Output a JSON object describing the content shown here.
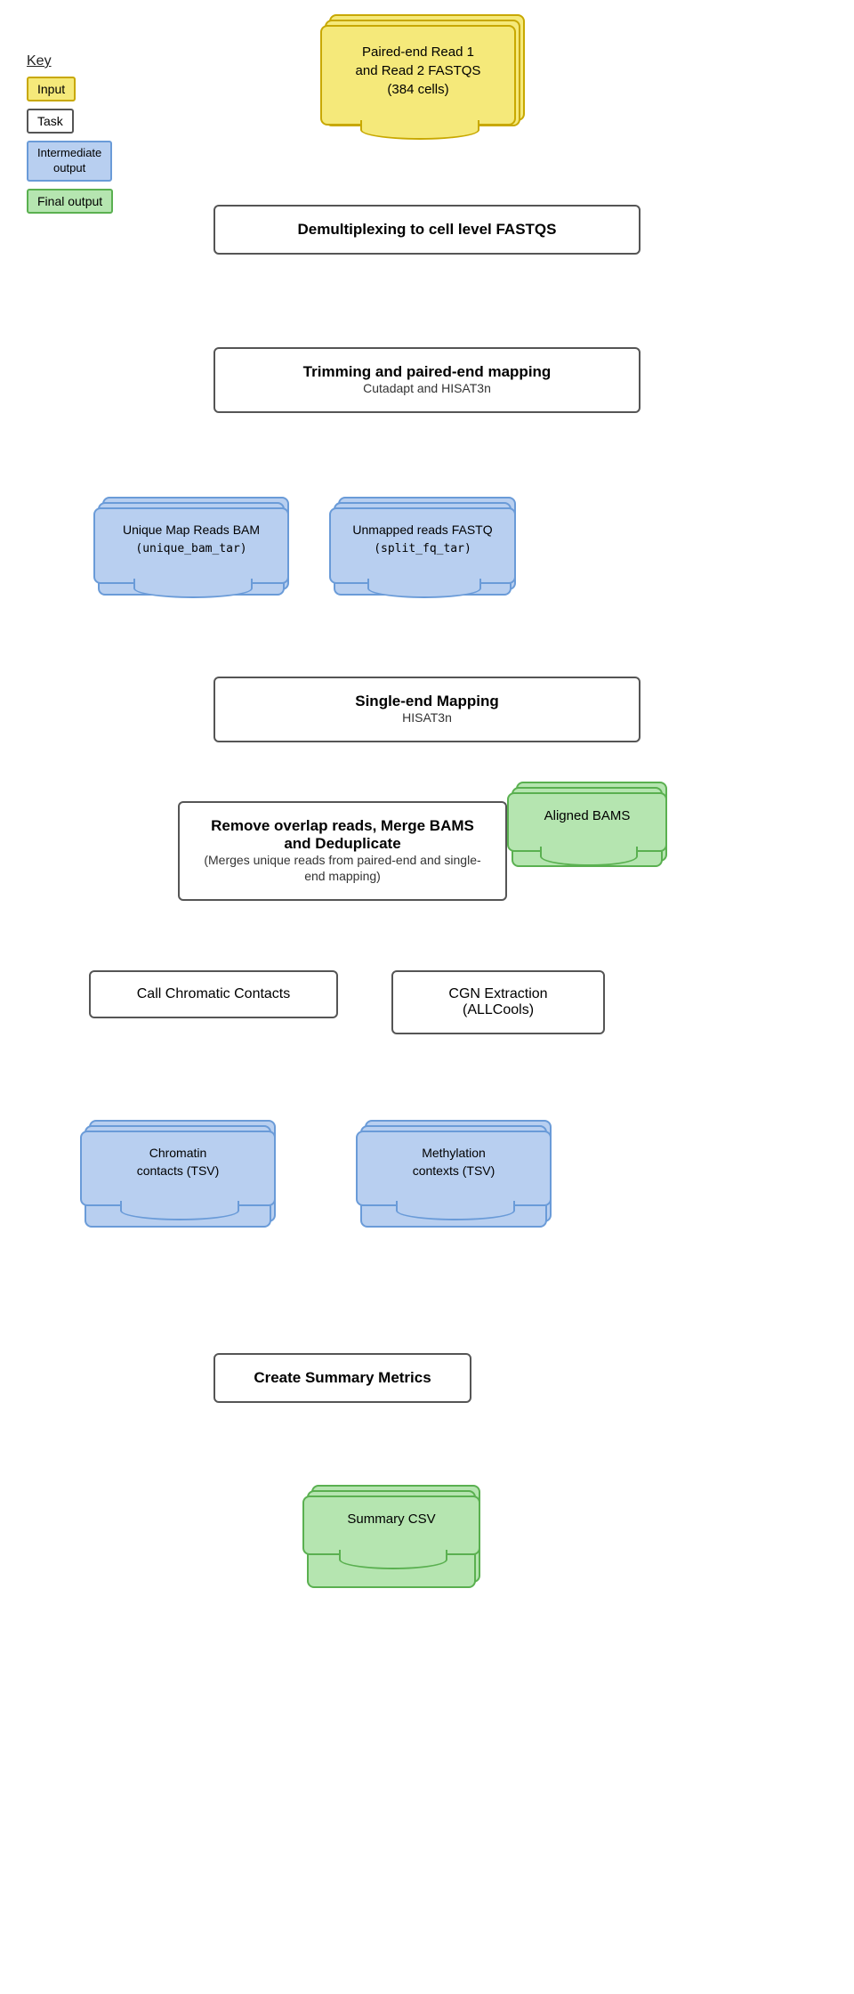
{
  "key": {
    "title": "Key",
    "input_label": "Input",
    "task_label": "Task",
    "intermediate_label": "Intermediate\noutput",
    "final_label": "Final output"
  },
  "fastq_input": {
    "line1": "Paired-end Read 1",
    "line2": "and Read 2 FASTQS",
    "line3": "(384 cells)"
  },
  "demux": {
    "title": "Demultiplexing to cell level FASTQS"
  },
  "trim": {
    "title": "Trimming and paired-end mapping",
    "subtitle": "Cutadapt and HISAT3n"
  },
  "unique_bam": {
    "line1": "Unique Map Reads BAM",
    "line2": "(unique_bam_tar)"
  },
  "unmapped_fq": {
    "line1": "Unmapped reads FASTQ",
    "line2": "(split_fq_tar)"
  },
  "single_end": {
    "title": "Single-end Mapping",
    "subtitle": "HISAT3n"
  },
  "merge": {
    "title": "Remove overlap reads, Merge BAMS  and Deduplicate",
    "subtitle": "(Merges unique reads from paired-end and single-end mapping)"
  },
  "aligned_bams": {
    "label": "Aligned BAMS"
  },
  "call_chromatic": {
    "label": "Call Chromatic Contacts"
  },
  "cgn_extraction": {
    "line1": "CGN Extraction",
    "line2": "(ALLCools)"
  },
  "chromatin_contacts": {
    "line1": "Chromatin",
    "line2": "contacts (TSV)"
  },
  "methylation_contexts": {
    "line1": "Methylation",
    "line2": "contexts (TSV)"
  },
  "create_summary": {
    "title": "Create Summary Metrics"
  },
  "summary_csv": {
    "label": "Summary CSV"
  },
  "colors": {
    "yellow_bg": "#f5e97a",
    "yellow_border": "#c8a800",
    "blue_bg": "#b8cff0",
    "blue_border": "#6a9bd8",
    "green_bg": "#b5e5b0",
    "green_border": "#5ab050",
    "task_border": "#555555",
    "arrow_color": "#444444"
  }
}
